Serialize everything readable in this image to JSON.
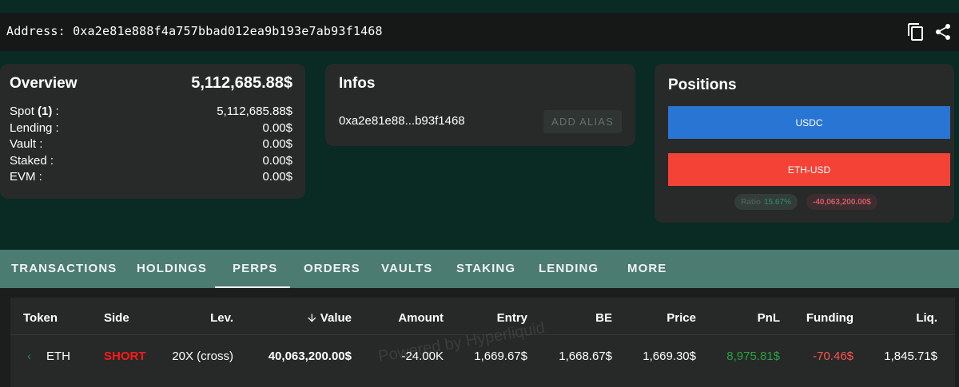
{
  "address_bar": {
    "label": "Address: 0xa2e81e888f4a757bbad012ea9b193e7ab93f1468",
    "icons": [
      "copy-icon",
      "share-icon"
    ]
  },
  "overview": {
    "title": "Overview",
    "total": "5,112,685.88$",
    "rows": [
      {
        "label_pre": "Spot ",
        "label_bold": "(1)",
        "label_post": " :",
        "value": "5,112,685.88$"
      },
      {
        "label_pre": "Lending :",
        "label_bold": "",
        "label_post": "",
        "value": "0.00$"
      },
      {
        "label_pre": "Vault :",
        "label_bold": "",
        "label_post": "",
        "value": "0.00$"
      },
      {
        "label_pre": "Staked :",
        "label_bold": "",
        "label_post": "",
        "value": "0.00$"
      },
      {
        "label_pre": "EVM :",
        "label_bold": "",
        "label_post": "",
        "value": "0.00$"
      }
    ]
  },
  "infos": {
    "title": "Infos",
    "short_address": "0xa2e81e88...b93f1468",
    "add_alias_label": "ADD ALIAS"
  },
  "positions": {
    "title": "Positions",
    "usdc_label": "USDC",
    "eth_label": "ETH-USD",
    "ratio_label": "Ratio",
    "ratio_value": "15.67%",
    "net_value": "-40,063,200.00$"
  },
  "tabs": [
    "TRANSACTIONS",
    "HOLDINGS",
    "PERPS",
    "ORDERS",
    "VAULTS",
    "STAKING",
    "LENDING",
    "MORE"
  ],
  "active_tab": "PERPS",
  "table": {
    "headers": {
      "token": "Token",
      "side": "Side",
      "lev": "Lev.",
      "value": "Value",
      "amount": "Amount",
      "entry": "Entry",
      "be": "BE",
      "price": "Price",
      "pnl": "PnL",
      "funding": "Funding",
      "liq": "Liq."
    },
    "rows": [
      {
        "token": "ETH",
        "side": "SHORT",
        "lev": "20X (cross)",
        "value": "40,063,200.00$",
        "amount": "-24.00K",
        "entry": "1,669.67$",
        "be": "1,668.67$",
        "price": "1,669.30$",
        "pnl": "8,975.81$",
        "funding": "-70.46$",
        "liq": "1,845.71$"
      }
    ],
    "watermark": "Powered by Hyperliquid"
  },
  "colors": {
    "background": "#0a2a24",
    "card": "#272a29",
    "usdc_bar": "#2975d4",
    "eth_bar": "#f44336",
    "tabs_bar": "#4b7b71",
    "short": "#ff1a1a",
    "pnl_positive": "#2ea043",
    "funding_negative": "#ff5252"
  }
}
